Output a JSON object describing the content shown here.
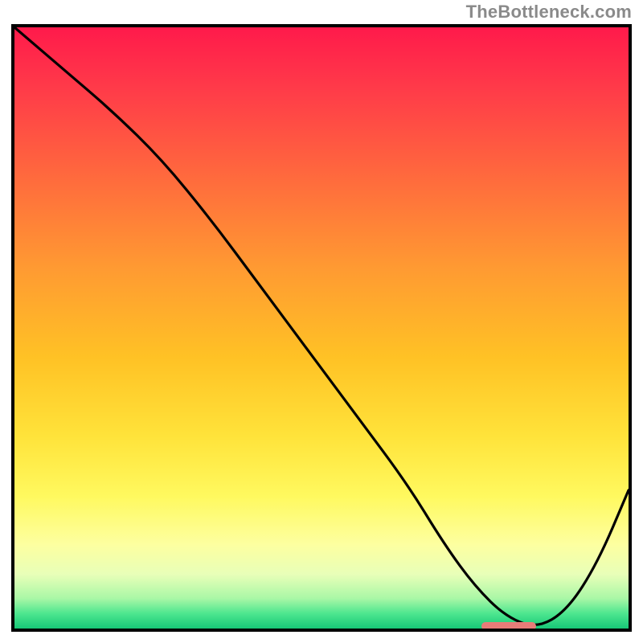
{
  "watermark": {
    "text": "TheBottleneck.com"
  },
  "chart_data": {
    "type": "line",
    "title": "",
    "xlabel": "",
    "ylabel": "",
    "xlim": [
      0,
      100
    ],
    "ylim": [
      0,
      100
    ],
    "x": [
      0,
      8,
      16,
      24,
      32,
      40,
      48,
      56,
      64,
      70,
      75,
      80,
      85,
      90,
      95,
      100
    ],
    "values": [
      100,
      93,
      86,
      78,
      68,
      57,
      46,
      35,
      24,
      14,
      7,
      2,
      0,
      3,
      11,
      23
    ],
    "grid": false,
    "legend": false,
    "marker": {
      "x_start": 76,
      "x_end": 85,
      "y": 0
    },
    "gradient_stops": [
      {
        "offset": 0.0,
        "color": "#ff1a4b"
      },
      {
        "offset": 0.1,
        "color": "#ff3a49"
      },
      {
        "offset": 0.25,
        "color": "#ff6a3d"
      },
      {
        "offset": 0.4,
        "color": "#ff9a32"
      },
      {
        "offset": 0.55,
        "color": "#ffc225"
      },
      {
        "offset": 0.68,
        "color": "#ffe33a"
      },
      {
        "offset": 0.78,
        "color": "#fff95f"
      },
      {
        "offset": 0.86,
        "color": "#fdffa0"
      },
      {
        "offset": 0.91,
        "color": "#e8ffb8"
      },
      {
        "offset": 0.95,
        "color": "#a9f7a6"
      },
      {
        "offset": 0.975,
        "color": "#4de68f"
      },
      {
        "offset": 1.0,
        "color": "#17c877"
      }
    ]
  }
}
